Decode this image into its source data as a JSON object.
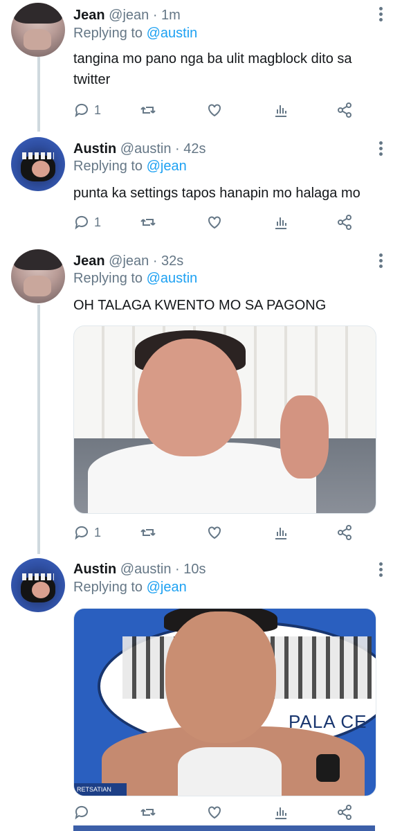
{
  "tweets": [
    {
      "name": "Jean",
      "handle": "@jean",
      "time": "· 1m",
      "replying_label": "Replying to",
      "replying_to": "@austin",
      "text": "tangina mo pano nga ba ulit magblock dito sa twitter",
      "reply_count": "1",
      "avatar": "jean-avatar"
    },
    {
      "name": "Austin",
      "handle": "@austin",
      "time": "· 42s",
      "replying_label": "Replying to",
      "replying_to": "@jean",
      "text": "punta ka settings tapos hanapin mo halaga mo",
      "reply_count": "1",
      "avatar": "austin-avatar"
    },
    {
      "name": "Jean",
      "handle": "@jean",
      "time": "· 32s",
      "replying_label": "Replying to",
      "replying_to": "@austin",
      "text": "OH TALAGA KWENTO MO SA PAGONG",
      "reply_count": "1",
      "avatar": "jean-avatar",
      "media": "photo"
    },
    {
      "name": "Austin",
      "handle": "@austin",
      "time": "· 10s",
      "replying_label": "Replying to",
      "replying_to": "@jean",
      "text": "",
      "reply_count": "",
      "avatar": "austin-avatar",
      "media": "photo",
      "media_overlay_text": "PALA  CE",
      "media_corner_text": "RETSATIAN"
    }
  ],
  "icons": {
    "reply": "reply-icon",
    "retweet": "retweet-icon",
    "like": "heart-icon",
    "analytics": "analytics-icon",
    "share": "share-icon",
    "more": "more-vertical-icon"
  },
  "colors": {
    "link": "#1da1f2",
    "secondary_text": "#657786",
    "thread_line": "#cfd9de"
  }
}
